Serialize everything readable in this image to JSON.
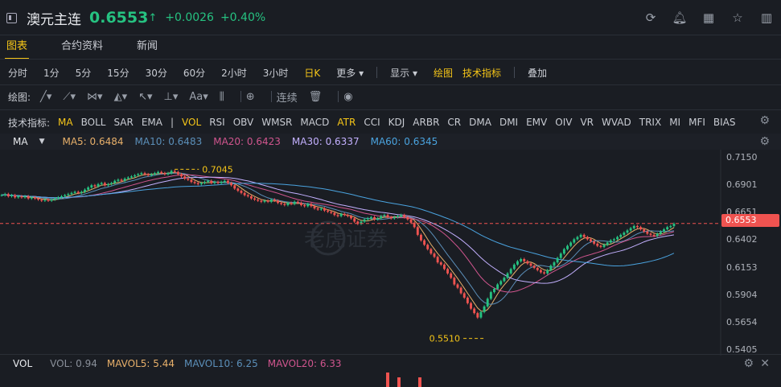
{
  "header": {
    "name": "澳元主连",
    "price": "0.6553",
    "arrow": "↑",
    "change": "+0.0026",
    "change_pct": "+0.40%"
  },
  "tabs": [
    {
      "label": "图表"
    },
    {
      "label": "合约资料"
    },
    {
      "label": "新闻"
    }
  ],
  "periods": [
    {
      "label": "分时"
    },
    {
      "label": "1分"
    },
    {
      "label": "5分"
    },
    {
      "label": "15分"
    },
    {
      "label": "30分"
    },
    {
      "label": "60分"
    },
    {
      "label": "2小时"
    },
    {
      "label": "3小时"
    },
    {
      "label": "日K"
    },
    {
      "label": "更多 ▾"
    }
  ],
  "period_tools": {
    "display": "显示 ▾",
    "draw": "绘图",
    "indicator": "技术指标",
    "overlay": "叠加"
  },
  "drawbar": {
    "label": "绘图:",
    "continuous": "连续"
  },
  "indicators": {
    "label": "技术指标:",
    "items": [
      "MA",
      "BOLL",
      "SAR",
      "EMA",
      "|",
      "VOL",
      "RSI",
      "OBV",
      "WMSR",
      "MACD",
      "ATR",
      "CCI",
      "KDJ",
      "ARBR",
      "CR",
      "DMA",
      "DMI",
      "EMV",
      "OIV",
      "VR",
      "WVAD",
      "TRIX",
      "MI",
      "MFI",
      "BIAS"
    ],
    "active": [
      "MA",
      "VOL",
      "ATR"
    ]
  },
  "ma_legend": {
    "name": "MA",
    "items": [
      {
        "label": "MA5: 0.6484",
        "color": "#e8b06a"
      },
      {
        "label": "MA10: 0.6483",
        "color": "#5b8fb9"
      },
      {
        "label": "MA20: 0.6423",
        "color": "#d0558e"
      },
      {
        "label": "MA30: 0.6337",
        "color": "#c3b0ff"
      },
      {
        "label": "MA60: 0.6345",
        "color": "#4aa3df"
      }
    ]
  },
  "vol_legend": {
    "name": "VOL",
    "items": [
      {
        "label": "VOL: 0.94",
        "color": "#8a909a"
      },
      {
        "label": "MAVOL5: 5.44",
        "color": "#e8b06a"
      },
      {
        "label": "MAVOL10: 6.25",
        "color": "#5b8fb9"
      },
      {
        "label": "MAVOL20: 6.33",
        "color": "#d0558e"
      }
    ]
  },
  "watermark": "老虎证券",
  "chart_data": {
    "type": "candlestick",
    "y_ticks": [
      "0.7150",
      "0.6901",
      "0.6651",
      "0.6402",
      "0.6153",
      "0.5904",
      "0.5654",
      "0.5405"
    ],
    "ylim": [
      0.5405,
      0.715
    ],
    "current_price": "0.6553",
    "annotations": [
      {
        "label": "0.7045",
        "value": 0.7045,
        "index": 52
      },
      {
        "label": "0.5510",
        "value": 0.551,
        "index": 145
      }
    ],
    "closes": [
      0.681,
      0.682,
      0.68,
      0.681,
      0.679,
      0.68,
      0.679,
      0.68,
      0.678,
      0.679,
      0.678,
      0.677,
      0.676,
      0.677,
      0.676,
      0.677,
      0.678,
      0.679,
      0.68,
      0.681,
      0.682,
      0.683,
      0.684,
      0.683,
      0.684,
      0.686,
      0.688,
      0.69,
      0.689,
      0.691,
      0.692,
      0.69,
      0.691,
      0.692,
      0.694,
      0.695,
      0.694,
      0.696,
      0.697,
      0.698,
      0.699,
      0.7,
      0.701,
      0.7,
      0.699,
      0.7,
      0.701,
      0.702,
      0.701,
      0.7,
      0.701,
      0.703,
      0.702,
      0.7,
      0.698,
      0.696,
      0.695,
      0.693,
      0.692,
      0.691,
      0.692,
      0.693,
      0.694,
      0.692,
      0.693,
      0.692,
      0.693,
      0.694,
      0.692,
      0.69,
      0.687,
      0.685,
      0.683,
      0.681,
      0.68,
      0.678,
      0.677,
      0.676,
      0.675,
      0.676,
      0.675,
      0.677,
      0.676,
      0.674,
      0.673,
      0.672,
      0.674,
      0.673,
      0.675,
      0.674,
      0.672,
      0.671,
      0.673,
      0.671,
      0.669,
      0.668,
      0.669,
      0.667,
      0.666,
      0.665,
      0.663,
      0.662,
      0.664,
      0.663,
      0.662,
      0.66,
      0.657,
      0.655,
      0.657,
      0.659,
      0.66,
      0.661,
      0.659,
      0.66,
      0.662,
      0.663,
      0.661,
      0.66,
      0.661,
      0.662,
      0.663,
      0.661,
      0.659,
      0.656,
      0.652,
      0.645,
      0.64,
      0.636,
      0.632,
      0.628,
      0.625,
      0.62,
      0.618,
      0.614,
      0.61,
      0.606,
      0.6,
      0.597,
      0.592,
      0.588,
      0.583,
      0.578,
      0.574,
      0.57,
      0.575,
      0.58,
      0.587,
      0.593,
      0.596,
      0.6,
      0.603,
      0.606,
      0.61,
      0.614,
      0.618,
      0.621,
      0.623,
      0.621,
      0.619,
      0.617,
      0.615,
      0.613,
      0.611,
      0.61,
      0.613,
      0.617,
      0.62,
      0.624,
      0.628,
      0.632,
      0.635,
      0.638,
      0.641,
      0.643,
      0.645,
      0.643,
      0.641,
      0.639,
      0.637,
      0.635,
      0.634,
      0.636,
      0.638,
      0.64,
      0.641,
      0.643,
      0.645,
      0.647,
      0.649,
      0.651,
      0.653,
      0.652,
      0.65,
      0.648,
      0.646,
      0.645,
      0.644,
      0.646,
      0.648,
      0.65,
      0.652,
      0.653,
      0.655
    ]
  }
}
